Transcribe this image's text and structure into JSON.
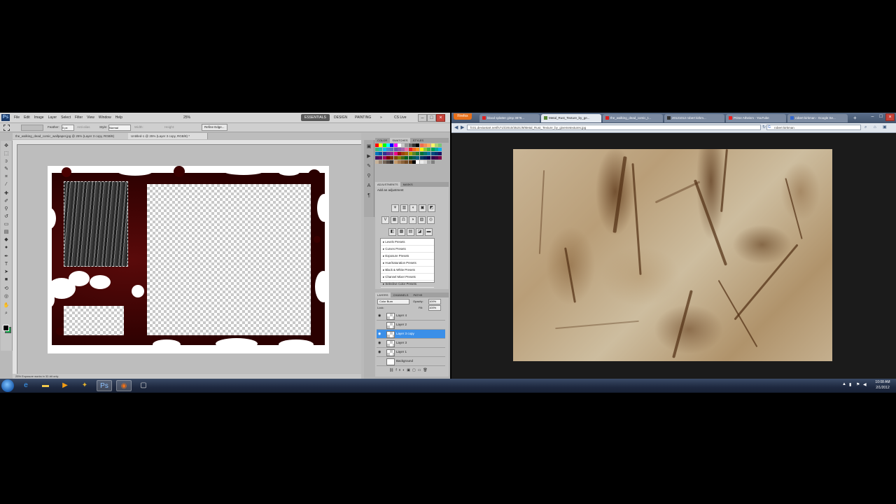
{
  "photoshop": {
    "logo": "Ps",
    "menu": [
      "File",
      "Edit",
      "Image",
      "Layer",
      "Select",
      "Filter",
      "View",
      "Window",
      "Help"
    ],
    "zoom": "25%",
    "workspaces": [
      "ESSENTIALS",
      "DESIGN",
      "PAINTING"
    ],
    "more_workspaces": "»",
    "cs_live": "CS Live",
    "window_controls": {
      "minimize": "–",
      "maximize": "□",
      "close": "×"
    },
    "options": {
      "feather_label": "Feather:",
      "feather_value": "0 px",
      "antialias_label": "Anti-alias",
      "style_label": "Style:",
      "style_value": "Normal",
      "width_label": "Width:",
      "height_label": "Height:",
      "refine_edge": "Refine Edge..."
    },
    "doc_tabs": [
      {
        "label": "the_walking_dead_comic_wallpaper.jpg @ 25% (Layer 3 copy, RGB/8)",
        "active": false
      },
      {
        "label": "Untitled-1 @ 25% (Layer 3 copy, RGB/8) *",
        "active": true
      }
    ],
    "status": "25%   Exposure works in 32-bit only",
    "panels": {
      "swatch_tabs": [
        "COLOR",
        "SWATCHES",
        "STYLES"
      ],
      "swatch_colors": [
        "#ff0000",
        "#ffff00",
        "#00ff00",
        "#00ffff",
        "#0000ff",
        "#ff00ff",
        "#ffffff",
        "#c8c8c8",
        "#969696",
        "#646464",
        "#323232",
        "#000000",
        "#f26c4f",
        "#f68e55",
        "#fbaf5c",
        "#fff467",
        "#acd372",
        "#7cc576",
        "#3bb878",
        "#1abbb4",
        "#00bff3",
        "#438ccb",
        "#5574b9",
        "#605ca8",
        "#855fa8",
        "#a763a8",
        "#f06ea9",
        "#ed1c24",
        "#f26522",
        "#f7941d",
        "#fff200",
        "#8dc73f",
        "#39b54a",
        "#00a651",
        "#00a99d",
        "#00aeef",
        "#0072bc",
        "#0054a6",
        "#2e3192",
        "#662d91",
        "#92278f",
        "#ec008c",
        "#9e0b0f",
        "#a0410d",
        "#a36209",
        "#aba000",
        "#598527",
        "#197b30",
        "#007236",
        "#00746b",
        "#0076a3",
        "#004b80",
        "#003471",
        "#1b1464",
        "#440e62",
        "#630460",
        "#9e005d",
        "#790000",
        "#7b2e00",
        "#7d4900",
        "#827b00",
        "#406618",
        "#005e20",
        "#005826",
        "#005952",
        "#005b7f",
        "#003663",
        "#002157",
        "#0d004c",
        "#32004b",
        "#4b0049",
        "#7b0046",
        "#c7b299",
        "#998675",
        "#736357",
        "#534741",
        "#37302d",
        "#c69c6d",
        "#a67c52",
        "#8c6239",
        "#754c24",
        "#603913",
        "#000000",
        "#ffffff",
        "#ececec",
        "#d9d9d9",
        "#a6a6a6",
        "#808080"
      ],
      "adjust_tabs": [
        "ADJUSTMENTS",
        "MASKS"
      ],
      "adjust_title": "Add an adjustment",
      "adjust_icons_row1": [
        "☀",
        "▥",
        "◐",
        "▣",
        "◩"
      ],
      "adjust_icons_row2": [
        "V",
        "▦",
        "⚖",
        "◑",
        "▨",
        "◎"
      ],
      "adjust_icons_row3": [
        "◧",
        "▩",
        "▤",
        "◪",
        "▬"
      ],
      "presets": [
        "Levels Presets",
        "Curves Presets",
        "Exposure Presets",
        "Hue/Saturation Presets",
        "Black & White Presets",
        "Channel Mixer Presets",
        "Selective Color Presets"
      ],
      "layers_tabs": [
        "LAYERS",
        "CHANNELS",
        "PATHS"
      ],
      "blend_mode": "Color Burn",
      "opacity_label": "Opacity:",
      "opacity_value": "100%",
      "lock_label": "Lock:",
      "fill_label": "Fill:",
      "fill_value": "100%",
      "layers": [
        {
          "name": "Layer 4",
          "selected": false,
          "visible": true
        },
        {
          "name": "Layer 2",
          "selected": false,
          "visible": false
        },
        {
          "name": "Layer 3 copy",
          "selected": true,
          "visible": true
        },
        {
          "name": "Layer 3",
          "selected": false,
          "visible": true
        },
        {
          "name": "Layer 1",
          "selected": false,
          "visible": true
        },
        {
          "name": "Background",
          "selected": false,
          "visible": false
        }
      ]
    }
  },
  "firefox": {
    "button": "Firefox",
    "tabs": [
      {
        "label": "blood splatter gimp 3878...",
        "active": false,
        "color": "#d22"
      },
      {
        "label": "Metal_Rust_Texture_by_ge...",
        "active": true,
        "color": "#5a8a3a"
      },
      {
        "label": "the_walking_dead_comic_t...",
        "active": false,
        "color": "#d22"
      },
      {
        "label": "20121012 robert kirkm...",
        "active": false,
        "color": "#333"
      },
      {
        "label": "Prime Atheism - YouTube",
        "active": false,
        "color": "#e22"
      },
      {
        "label": "robert kirkman - Google Se...",
        "active": false,
        "color": "#36c"
      }
    ],
    "new_tab": "+",
    "url": "fc01.deviantart.net/fs71/i/2010/352/c/8/Metal_Rust_Texture_by_givemetextures.jpg",
    "search": "robert kirkman",
    "window_controls": {
      "minimize": "–",
      "maximize": "□",
      "close": "×"
    }
  },
  "taskbar": {
    "apps": [
      {
        "icon": "e",
        "name": "ie-icon",
        "color": "#3aa0ff",
        "active": false
      },
      {
        "icon": "▬",
        "name": "explorer-icon",
        "color": "#f2c94c",
        "active": false
      },
      {
        "icon": "▶",
        "name": "media-player-icon",
        "color": "#f39c12",
        "active": false
      },
      {
        "icon": "✦",
        "name": "app-icon",
        "color": "#e0b030",
        "active": false
      },
      {
        "icon": "Ps",
        "name": "photoshop-icon",
        "color": "#8fc3ff",
        "active": true
      },
      {
        "icon": "◉",
        "name": "firefox-icon",
        "color": "#e8701a",
        "active": true
      },
      {
        "icon": "▢",
        "name": "window-icon",
        "color": "#ddd",
        "active": false
      }
    ],
    "time": "10:08 AM",
    "date": "2/1/2012"
  }
}
